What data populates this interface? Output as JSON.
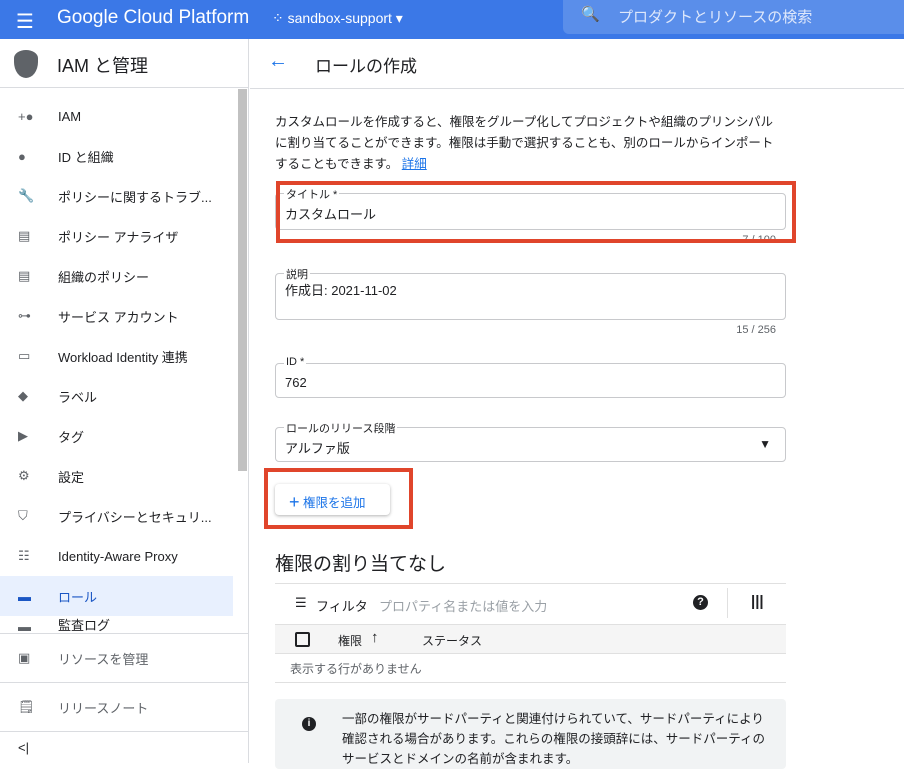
{
  "header": {
    "brand": "Google Cloud Platform",
    "project": "sandbox-support",
    "search_placeholder": "プロダクトとリソースの検索"
  },
  "sidebar": {
    "title": "IAM と管理",
    "items": [
      {
        "label": "IAM",
        "icon": "person-add-icon",
        "g": "+●"
      },
      {
        "label": "ID と組織",
        "icon": "account-circle-icon",
        "g": "●"
      },
      {
        "label": "ポリシーに関するトラブ...",
        "icon": "wrench-icon",
        "g": "🔧"
      },
      {
        "label": "ポリシー アナライザ",
        "icon": "document-search-icon",
        "g": "▤"
      },
      {
        "label": "組織のポリシー",
        "icon": "list-icon",
        "g": "▤"
      },
      {
        "label": "サービス アカウント",
        "icon": "service-account-icon",
        "g": "⊶"
      },
      {
        "label": "Workload Identity 連携",
        "icon": "id-card-icon",
        "g": "▭"
      },
      {
        "label": "ラベル",
        "icon": "label-icon",
        "g": "◆"
      },
      {
        "label": "タグ",
        "icon": "tag-icon",
        "g": "▶"
      },
      {
        "label": "設定",
        "icon": "gear-icon",
        "g": "⚙"
      },
      {
        "label": "プライバシーとセキュリ...",
        "icon": "shield-icon",
        "g": "⛉"
      },
      {
        "label": "Identity-Aware Proxy",
        "icon": "proxy-icon",
        "g": "☷"
      },
      {
        "label": "ロール",
        "icon": "roles-icon",
        "g": "▬",
        "active": true
      },
      {
        "label": "監査ログ",
        "icon": "audit-log-icon",
        "g": "▬"
      }
    ],
    "manage_resources": "リソースを管理",
    "release_notes": "リリースノート",
    "collapse": "<|"
  },
  "page": {
    "title": "ロールの作成",
    "intro": "カスタムロールを作成すると、権限をグループ化してプロジェクトや組織のプリンシパルに割り当てることができます。権限は手動で選択することも、別のロールからインポートすることもできます。",
    "learn_more": "詳細",
    "title_field": {
      "label": "タイトル *",
      "value": "カスタムロール",
      "counter": "7 / 100"
    },
    "desc_field": {
      "label": "説明",
      "value": "作成日: 2021-11-02",
      "counter": "15 / 256"
    },
    "id_field": {
      "label": "ID *",
      "value": "762"
    },
    "stage_field": {
      "label": "ロールのリリース段階",
      "value": "アルファ版"
    },
    "add_permissions": "権限を追加",
    "section_title": "権限の割り当てなし",
    "filter_label": "フィルタ",
    "filter_placeholder": "プロパティ名または値を入力",
    "columns": [
      "権限",
      "ステータス"
    ],
    "empty": "表示する行がありません",
    "info": "一部の権限がサードパーティと関連付けられていて、サードパーティにより確認される場合があります。これらの権限の接頭辞には、サードパーティのサービスとドメインの名前が含まれます。"
  },
  "colors": {
    "header": "#3b78e7",
    "accent": "#1a73e8",
    "highlight": "#e0452b"
  }
}
